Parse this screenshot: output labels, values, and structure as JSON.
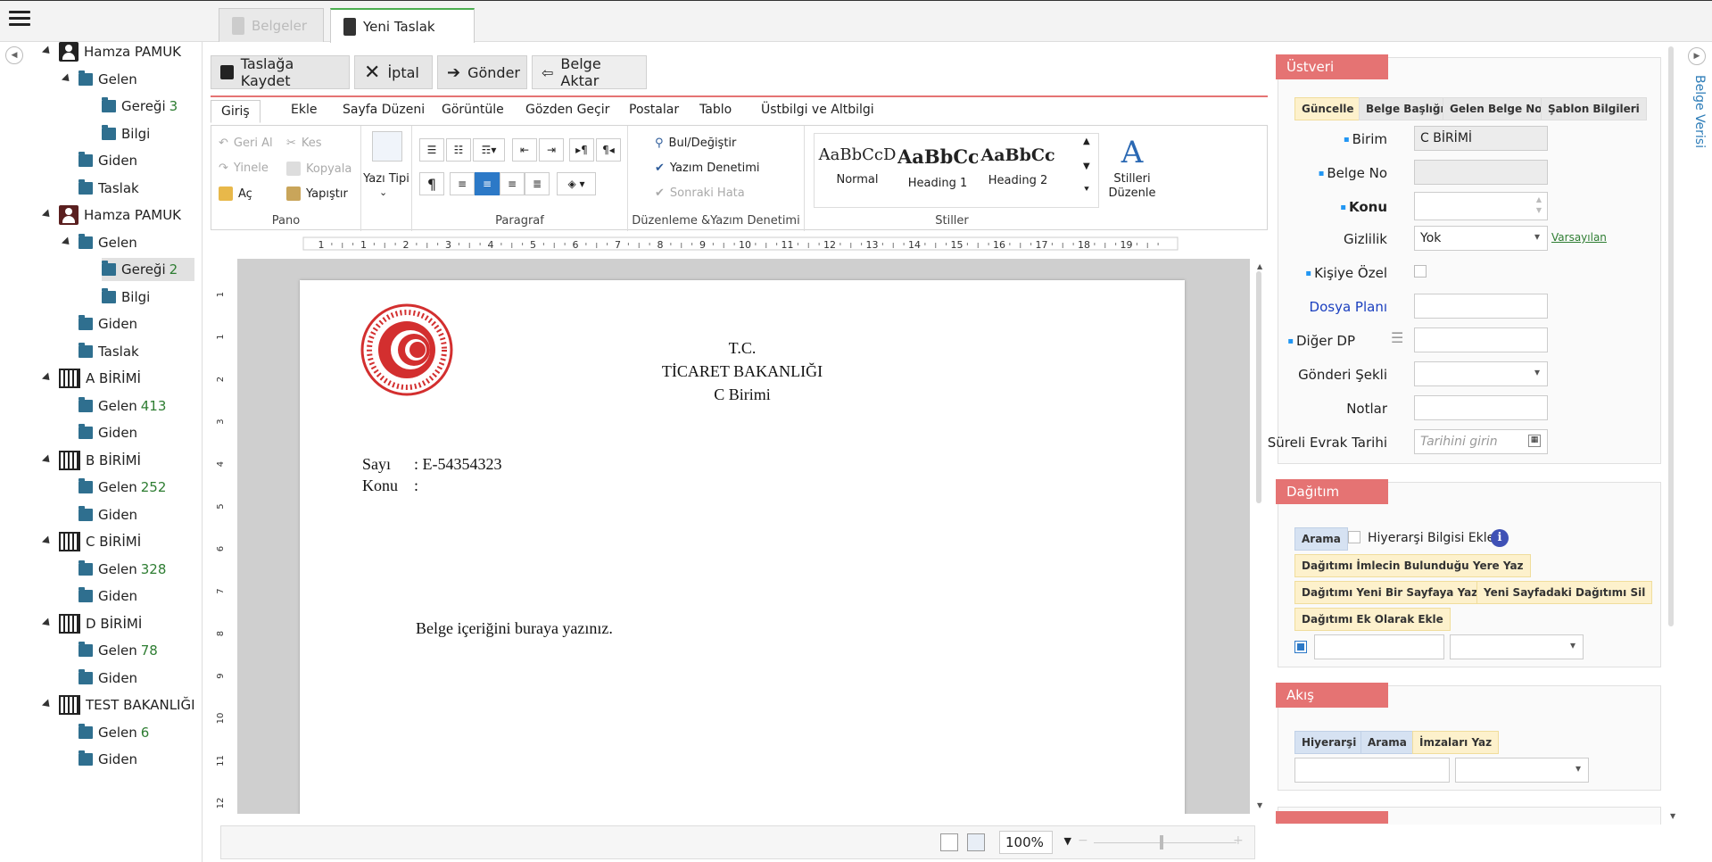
{
  "tabs": [
    {
      "label": "Belgeler",
      "active": false
    },
    {
      "label": "Yeni Taslak",
      "active": true
    }
  ],
  "tree": {
    "groups": [
      {
        "label": "Hamza PAMUK",
        "icon": "person-icon",
        "children": [
          {
            "label": "Gelen",
            "children": [
              {
                "label": "Gereği",
                "count": "3"
              },
              {
                "label": "Bilgi"
              }
            ]
          },
          {
            "label": "Giden"
          },
          {
            "label": "Taslak"
          }
        ]
      },
      {
        "label": "Hamza PAMUK",
        "icon": "person-alt-icon",
        "children": [
          {
            "label": "Gelen",
            "children": [
              {
                "label": "Gereği",
                "count": "2",
                "selected": true
              },
              {
                "label": "Bilgi"
              }
            ]
          },
          {
            "label": "Giden"
          },
          {
            "label": "Taslak"
          }
        ]
      },
      {
        "label": "A BİRİMİ",
        "children": [
          {
            "label": "Gelen",
            "count": "413"
          },
          {
            "label": "Giden"
          }
        ]
      },
      {
        "label": "B BİRİMİ",
        "children": [
          {
            "label": "Gelen",
            "count": "252"
          },
          {
            "label": "Giden"
          }
        ]
      },
      {
        "label": "C BİRİMİ",
        "children": [
          {
            "label": "Gelen",
            "count": "328"
          },
          {
            "label": "Giden"
          }
        ]
      },
      {
        "label": "D BİRİMİ",
        "children": [
          {
            "label": "Gelen",
            "count": "78"
          },
          {
            "label": "Giden"
          }
        ]
      },
      {
        "label": "TEST BAKANLIĞI",
        "children": [
          {
            "label": "Gelen",
            "count": "6"
          },
          {
            "label": "Giden"
          }
        ]
      }
    ]
  },
  "toolbar": {
    "save": "Taslağa Kaydet",
    "cancel": "İptal",
    "send": "Gönder",
    "export": "Belge Aktar"
  },
  "ribbon": {
    "tabs": [
      "Giriş",
      "Ekle",
      "Sayfa Düzeni",
      "Görüntüle",
      "Gözden Geçir",
      "Postalar",
      "Tablo",
      "Üstbilgi ve Altbilgi"
    ],
    "pano": {
      "label": "Pano",
      "undo": "Geri Al",
      "redo": "Yinele",
      "open": "Aç",
      "cut": "Kes",
      "copy": "Kopyala",
      "paste": "Yapıştır"
    },
    "font": {
      "label": "Yazı Tipi"
    },
    "paragraph": {
      "label": "Paragraf"
    },
    "editing": {
      "label": "Düzenleme &Yazım Denetimi",
      "find": "Bul/Değiştir",
      "spell": "Yazım Denetimi",
      "next_error": "Sonraki Hata"
    },
    "styles": {
      "label": "Stiller",
      "items": [
        {
          "sample": "AaBbCcD",
          "name": "Normal"
        },
        {
          "sample": "AaBbCc",
          "name": "Heading 1"
        },
        {
          "sample": "AaBbCc",
          "name": "Heading 2"
        }
      ],
      "edit_line1": "Stilleri",
      "edit_line2": "Düzenle"
    }
  },
  "ruler": {
    "ticks": [
      "1",
      "1",
      "2",
      "3",
      "4",
      "5",
      "6",
      "7",
      "8",
      "9",
      "10",
      "11",
      "12",
      "13",
      "14",
      "15",
      "16",
      "17",
      "18",
      "19"
    ]
  },
  "vruler": {
    "ticks": [
      "1",
      "1",
      "2",
      "3",
      "4",
      "5",
      "6",
      "7",
      "8",
      "9",
      "10",
      "11",
      "12"
    ]
  },
  "document": {
    "header_1": "T.C.",
    "header_2": "TİCARET BAKANLIĞI",
    "header_3": "C Birimi",
    "sayi_label": "Sayı",
    "sayi_value": ":  E-54354323",
    "konu_label": "Konu",
    "konu_value": ":",
    "body": "Belge içeriğini buraya yazınız."
  },
  "status": {
    "zoom": "100%"
  },
  "ustveri": {
    "title": "Üstveri",
    "chips": [
      "Güncelle",
      "Belge Başlığı",
      "Gelen Belge No",
      "Şablon Bilgileri"
    ],
    "fields": {
      "birim_label": "Birim",
      "birim_value": "C BİRİMİ",
      "belge_no_label": "Belge No",
      "konu_label": "Konu",
      "gizlilik_label": "Gizlilik",
      "gizlilik_value": "Yok",
      "varsayilan": "Varsayılan",
      "kisiye_ozel_label": "Kişiye Özel",
      "dosya_plani_label": "Dosya Planı",
      "diger_dp_label": "Diğer DP",
      "gonderi_sekli_label": "Gönderi Şekli",
      "notlar_label": "Notlar",
      "sureli_label": "Süreli Evrak Tarihi",
      "sureli_placeholder": "Tarihini girin"
    }
  },
  "dagitim": {
    "title": "Dağıtım",
    "arama": "Arama",
    "hierarchy_label": "Hiyerarşi Bilgisi Ekle",
    "buttons": [
      "Dağıtımı İmlecin Bulunduğu Yere Yaz",
      "Dağıtımı Yeni Bir Sayfaya Yazdır",
      "Yeni Sayfadaki Dağıtımı Sil",
      "Dağıtımı Ek Olarak Ekle"
    ]
  },
  "akis": {
    "title": "Akış",
    "chips": [
      "Hiyerarşi",
      "Arama",
      "İmzaları Yaz"
    ]
  },
  "side_tab": "Belge Verisi",
  "colors": {
    "accent_red": "#e57373",
    "count_green": "#2e7d32",
    "tab_green": "#4caf50",
    "link_blue": "#1a3fbf"
  }
}
